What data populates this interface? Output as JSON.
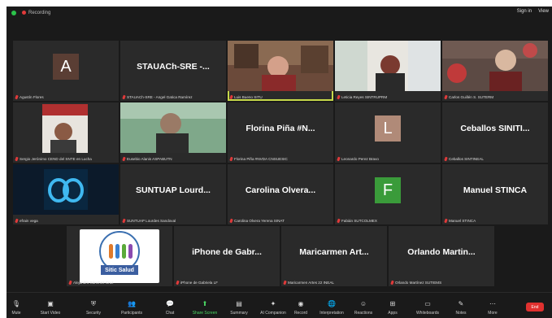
{
  "topbar": {
    "recording": "Recording",
    "sign_in": "Sign in",
    "view": "View"
  },
  "tiles": [
    {
      "name": "Agustín Flores",
      "avatar": "A",
      "avatar_color": "#5a3e34"
    },
    {
      "name": "STAUACh-SRE - Angel Gatica Ramírez",
      "big": "STAUACh-SRE -..."
    },
    {
      "name": "Luis Bueno SITU",
      "active": true
    },
    {
      "name": "Leticia Reyes SINTRUPRM"
    },
    {
      "name": "Carlos Guillén S. SUTERM"
    },
    {
      "name": "Sergio Jerónimo CEND del SNTE en Lucha"
    },
    {
      "name": "Eusebio Alanis ASPABUTN"
    },
    {
      "name": "Florina Piña #NVDA CNSUESIC",
      "big": "Florina Piña #N..."
    },
    {
      "name": "Leonardo Perez Bravo",
      "avatar": "L",
      "avatar_color": "#b08a78"
    },
    {
      "name": "Ceballos SINTINEAL",
      "big": "Ceballos SINITI..."
    },
    {
      "name": "efrain vega"
    },
    {
      "name": "SUNTUAP Lourdes Sandoval",
      "big": "SUNTUAP Lourd..."
    },
    {
      "name": "Carolina Olvera Yerena SINAT",
      "big": "Carolina Olvera..."
    },
    {
      "name": "Fabián SUTCOLMEX",
      "avatar": "F",
      "avatar_color": "#3a9b3a"
    },
    {
      "name": "Manuel STINCA",
      "big": "Manuel STINCA"
    },
    {
      "name": "Alejandro Sánchez Cruz",
      "logo": "Sitic Salud"
    },
    {
      "name": "iPhone de Gabriela LF",
      "big": "iPhone de Gabr..."
    },
    {
      "name": "Maricarmen Artes 22 INEAL",
      "big": "Maricarmen Art..."
    },
    {
      "name": "Orlando Martínez SUTIEMS",
      "big": "Orlando Martin..."
    }
  ],
  "toolbar": [
    {
      "label": "Mute",
      "icon": "microphone-icon"
    },
    {
      "label": "Start Video",
      "icon": "video-off-icon"
    },
    {
      "label": "Security",
      "icon": "shield-icon"
    },
    {
      "label": "Participants",
      "icon": "participants-icon"
    },
    {
      "label": "Chat",
      "icon": "chat-icon"
    },
    {
      "label": "Share Screen",
      "icon": "share-screen-icon"
    },
    {
      "label": "Summary",
      "icon": "summary-icon"
    },
    {
      "label": "AI Companion",
      "icon": "ai-companion-icon"
    },
    {
      "label": "Record",
      "icon": "record-icon"
    },
    {
      "label": "Interpretation",
      "icon": "globe-icon"
    },
    {
      "label": "Reactions",
      "icon": "reactions-icon"
    },
    {
      "label": "Apps",
      "icon": "apps-icon"
    },
    {
      "label": "Whiteboards",
      "icon": "whiteboard-icon"
    },
    {
      "label": "Notes",
      "icon": "notes-icon"
    },
    {
      "label": "More",
      "icon": "more-icon"
    }
  ],
  "end_label": "End"
}
